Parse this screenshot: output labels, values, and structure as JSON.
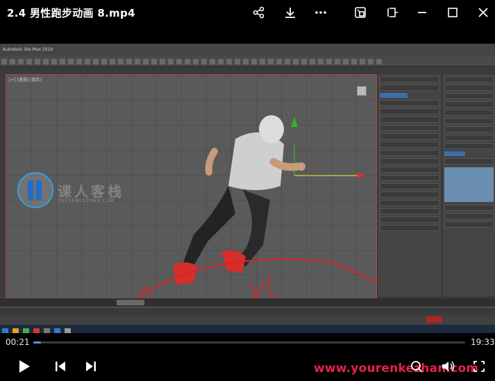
{
  "window": {
    "title": "2.4 男性跑步动画 8.mp4",
    "icons": [
      "share-icon",
      "download-icon",
      "more-icon",
      "picture-in-picture-icon",
      "pin-icon",
      "minimize-icon",
      "maximize-icon",
      "close-icon"
    ]
  },
  "video_frame": {
    "app_title": "Autodesk 3ds Max 2018",
    "viewport_label": "[+] [透视] [真实]",
    "watermark": {
      "brand": "课人客栈",
      "sub": "YOURENKEZHAN.COM"
    }
  },
  "player": {
    "current_time": "00:21",
    "duration": "19:33",
    "progress": 0.018,
    "site_watermark": "www.yourenkezhan.com",
    "controls": [
      "play-icon",
      "previous-icon",
      "next-icon",
      "search-icon",
      "volume-icon",
      "fullscreen-icon"
    ],
    "accent_color": "#5a8ef5"
  }
}
